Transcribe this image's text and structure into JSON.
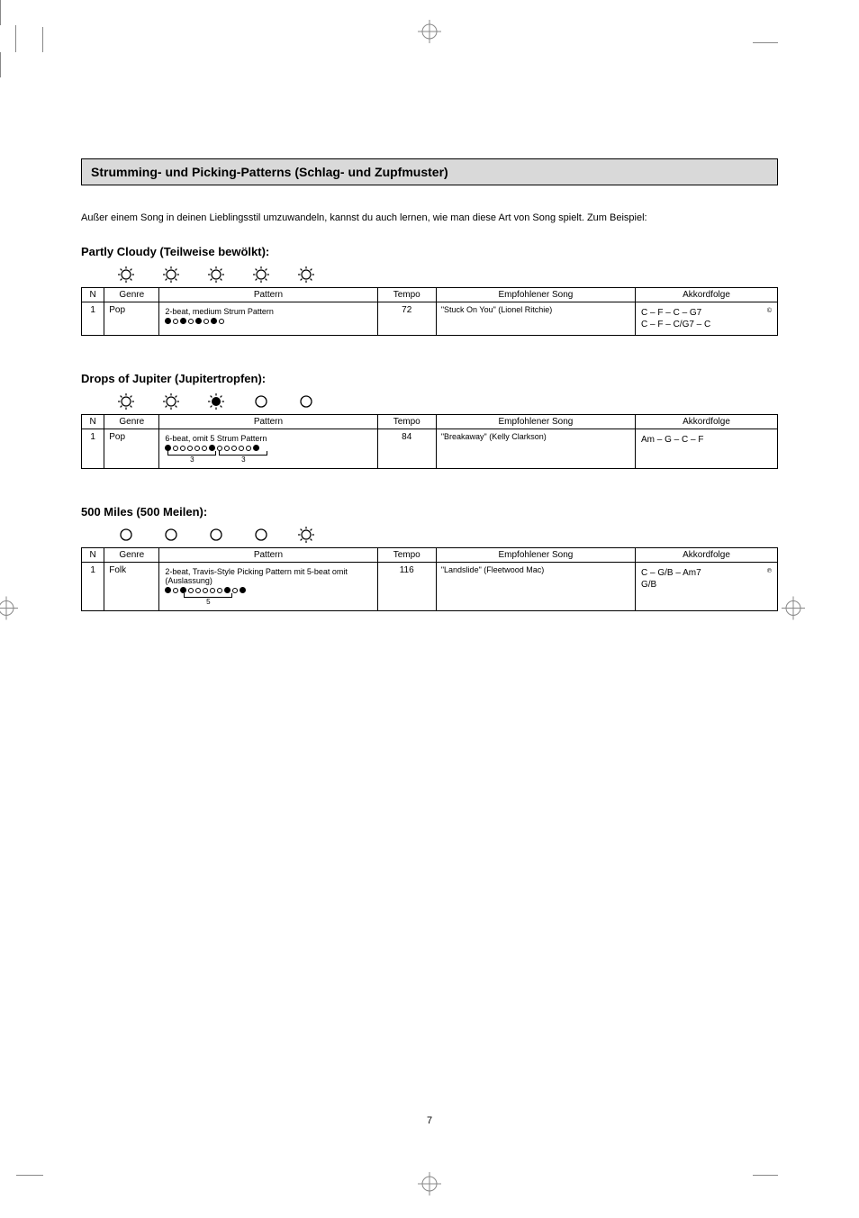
{
  "title": "Strumming- und Picking-Patterns (Schlag- und Zupfmuster)",
  "intro": "Außer einem Song in deinen Lieblingsstil umzuwandeln, kannst du auch lernen, wie man diese Art von Song spielt. Zum Beispiel:",
  "sections": [
    {
      "label": "Partly Cloudy (Teilweise bewölkt):",
      "icons": [
        "sun",
        "sun",
        "sun",
        "sun",
        "sun"
      ],
      "row": {
        "n": "1",
        "genre": "Pop",
        "pattern_desc": "2-beat, medium Strum Pattern",
        "dots": [
          "f",
          "o",
          "f",
          "o",
          "f",
          "o",
          "f",
          "o"
        ],
        "braces": [],
        "tempo": "72",
        "recommend": "\"Stuck On You\" (Lionel Ritchie)",
        "chord_lines": [
          "C – F – C – G7",
          "C – F – C/G7 – C"
        ],
        "chord_super": "©"
      }
    },
    {
      "label": "Drops of Jupiter (Jupitertropfen):",
      "icons": [
        "sun",
        "sun",
        "sunfill",
        "circle",
        "circle"
      ],
      "row": {
        "n": "1",
        "genre": "Pop",
        "pattern_desc": "6-beat, omit 5 Strum Pattern",
        "dots": [
          "f",
          "o",
          "o",
          "o",
          "o",
          "o",
          "f",
          "o",
          "o",
          "o",
          "o",
          "o",
          "f"
        ],
        "braces": [
          {
            "start": 0,
            "len": 6,
            "label": "3"
          },
          {
            "start": 6,
            "len": 6,
            "label": "3"
          }
        ],
        "tempo": "84",
        "recommend": "\"Breakaway\" (Kelly Clarkson)",
        "chord_lines": [
          "Am – G – C – F"
        ],
        "chord_super": ""
      }
    },
    {
      "label": "500 Miles (500 Meilen):",
      "icons": [
        "circle",
        "circle",
        "circle",
        "circle",
        "sun"
      ],
      "row": {
        "n": "1",
        "genre": "Folk",
        "pattern_desc": "2-beat, Travis-Style Picking Pattern mit 5-beat omit (Auslassung)",
        "dots": [
          "f",
          "o",
          "f",
          "o",
          "o",
          "o",
          "o",
          "o",
          "f",
          "o",
          "f"
        ],
        "braces": [
          {
            "start": 2,
            "len": 6,
            "label": "5"
          }
        ],
        "tempo": "116",
        "recommend": "\"Landslide\" (Fleetwood Mac)",
        "chord_lines": [
          "C – G/B – Am7",
          "G/B"
        ],
        "chord_super": "℗"
      }
    }
  ],
  "headers": {
    "n": "N",
    "genre": "Genre",
    "pattern": "Pattern",
    "tempo": "Tempo",
    "recommend": "Empfohlener Song",
    "chord": "Akkordfolge"
  },
  "page_number": "7"
}
